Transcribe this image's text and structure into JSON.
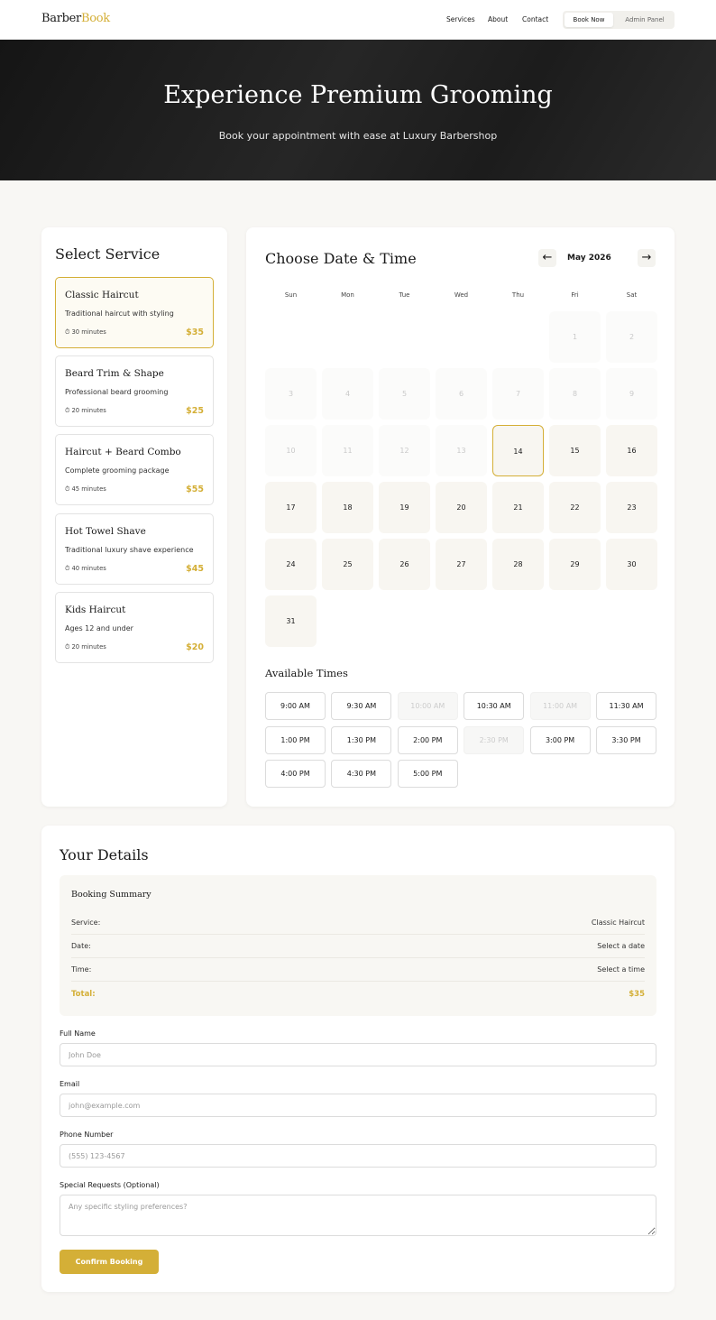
{
  "nav": {
    "logo_part1": "Barber",
    "logo_part2": "Book",
    "links": [
      "Services",
      "About",
      "Contact"
    ],
    "book_now": "Book Now",
    "admin_panel": "Admin Panel"
  },
  "hero": {
    "title": "Experience Premium Grooming",
    "subtitle": "Book your appointment with ease at Luxury Barbershop"
  },
  "services": {
    "title": "Select Service",
    "items": [
      {
        "name": "Classic Haircut",
        "desc": "Traditional haircut with styling",
        "duration": "30 minutes",
        "price": "$35",
        "selected": true
      },
      {
        "name": "Beard Trim & Shape",
        "desc": "Professional beard grooming",
        "duration": "20 minutes",
        "price": "$25",
        "selected": false
      },
      {
        "name": "Haircut + Beard Combo",
        "desc": "Complete grooming package",
        "duration": "45 minutes",
        "price": "$55",
        "selected": false
      },
      {
        "name": "Hot Towel Shave",
        "desc": "Traditional luxury shave experience",
        "duration": "40 minutes",
        "price": "$45",
        "selected": false
      },
      {
        "name": "Kids Haircut",
        "desc": "Ages 12 and under",
        "duration": "20 minutes",
        "price": "$20",
        "selected": false
      }
    ]
  },
  "calendar": {
    "title": "Choose Date & Time",
    "prev": "←",
    "next": "→",
    "month": "May 2026",
    "weekdays": [
      "Sun",
      "Mon",
      "Tue",
      "Wed",
      "Thu",
      "Fri",
      "Sat"
    ],
    "first_weekday": 5,
    "days_in_month": 31,
    "disabled_before": 14,
    "today": 14,
    "times_title": "Available Times",
    "times": [
      {
        "label": "9:00 AM",
        "available": true
      },
      {
        "label": "9:30 AM",
        "available": true
      },
      {
        "label": "10:00 AM",
        "available": false
      },
      {
        "label": "10:30 AM",
        "available": true
      },
      {
        "label": "11:00 AM",
        "available": false
      },
      {
        "label": "11:30 AM",
        "available": true
      },
      {
        "label": "1:00 PM",
        "available": true
      },
      {
        "label": "1:30 PM",
        "available": true
      },
      {
        "label": "2:00 PM",
        "available": true
      },
      {
        "label": "2:30 PM",
        "available": false
      },
      {
        "label": "3:00 PM",
        "available": true
      },
      {
        "label": "3:30 PM",
        "available": true
      },
      {
        "label": "4:00 PM",
        "available": true
      },
      {
        "label": "4:30 PM",
        "available": true
      },
      {
        "label": "5:00 PM",
        "available": true
      }
    ]
  },
  "details": {
    "title": "Your Details",
    "summary_title": "Booking Summary",
    "summary": [
      {
        "key": "Service:",
        "value": "Classic Haircut"
      },
      {
        "key": "Date:",
        "value": "Select a date"
      },
      {
        "key": "Time:",
        "value": "Select a time"
      }
    ],
    "total_label": "Total:",
    "total_value": "$35",
    "fields": {
      "name_label": "Full Name",
      "name_placeholder": "John Doe",
      "email_label": "Email",
      "email_placeholder": "john@example.com",
      "phone_label": "Phone Number",
      "phone_placeholder": "(555) 123-4567",
      "requests_label": "Special Requests (Optional)",
      "requests_placeholder": "Any specific styling preferences?"
    },
    "confirm": "Confirm Booking"
  },
  "colors": {
    "accent": "#d4af37",
    "dark": "#1a1a1a",
    "background": "#f8f7f4"
  }
}
